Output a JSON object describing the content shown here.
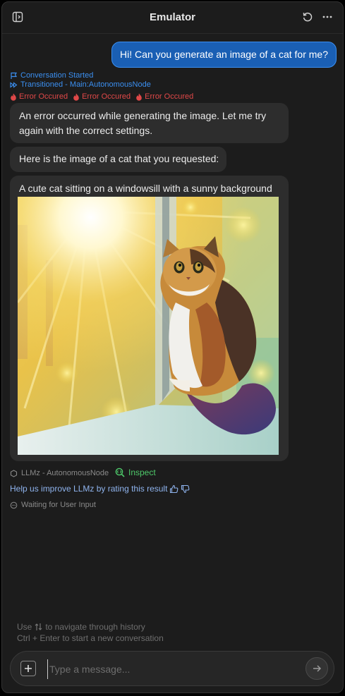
{
  "header": {
    "title": "Emulator",
    "left_icon": "sidebar-toggle-icon",
    "right_icons": [
      "refresh-icon",
      "more-icon"
    ]
  },
  "user_message": "Hi! Can you generate an image of a cat for me?",
  "events": {
    "started": "Conversation Started",
    "transitioned": "Transitioned - Main:AutonomousNode",
    "errors": [
      "Error Occured",
      "Error Occured",
      "Error Occured"
    ]
  },
  "assistant": {
    "message_1_line_1": "An error occurred while generating the image. Let me try",
    "message_1_line_2": "again with the correct settings.",
    "message_2": "Here is the image of a cat that you requested:",
    "image_caption": "A cute cat sitting on a windowsill with a sunny background"
  },
  "meta": {
    "node_label": "LLMz - AutonomousNode",
    "inspect_label": "Inspect",
    "rating_prompt": "Help us improve LLMz by rating this result",
    "waiting_status": "Waiting for User Input"
  },
  "hints": {
    "history_prefix": "Use",
    "history_suffix": "to navigate through history",
    "new_conversation": "Ctrl + Enter to start a new conversation"
  },
  "composer": {
    "placeholder": "Type a message...",
    "value": ""
  },
  "colors": {
    "accent_blue": "#1a5fb4",
    "event_blue": "#3b8ff0",
    "error_red": "#e04848",
    "inspect_green": "#4ec96a",
    "rating_link": "#8fb4ee"
  }
}
